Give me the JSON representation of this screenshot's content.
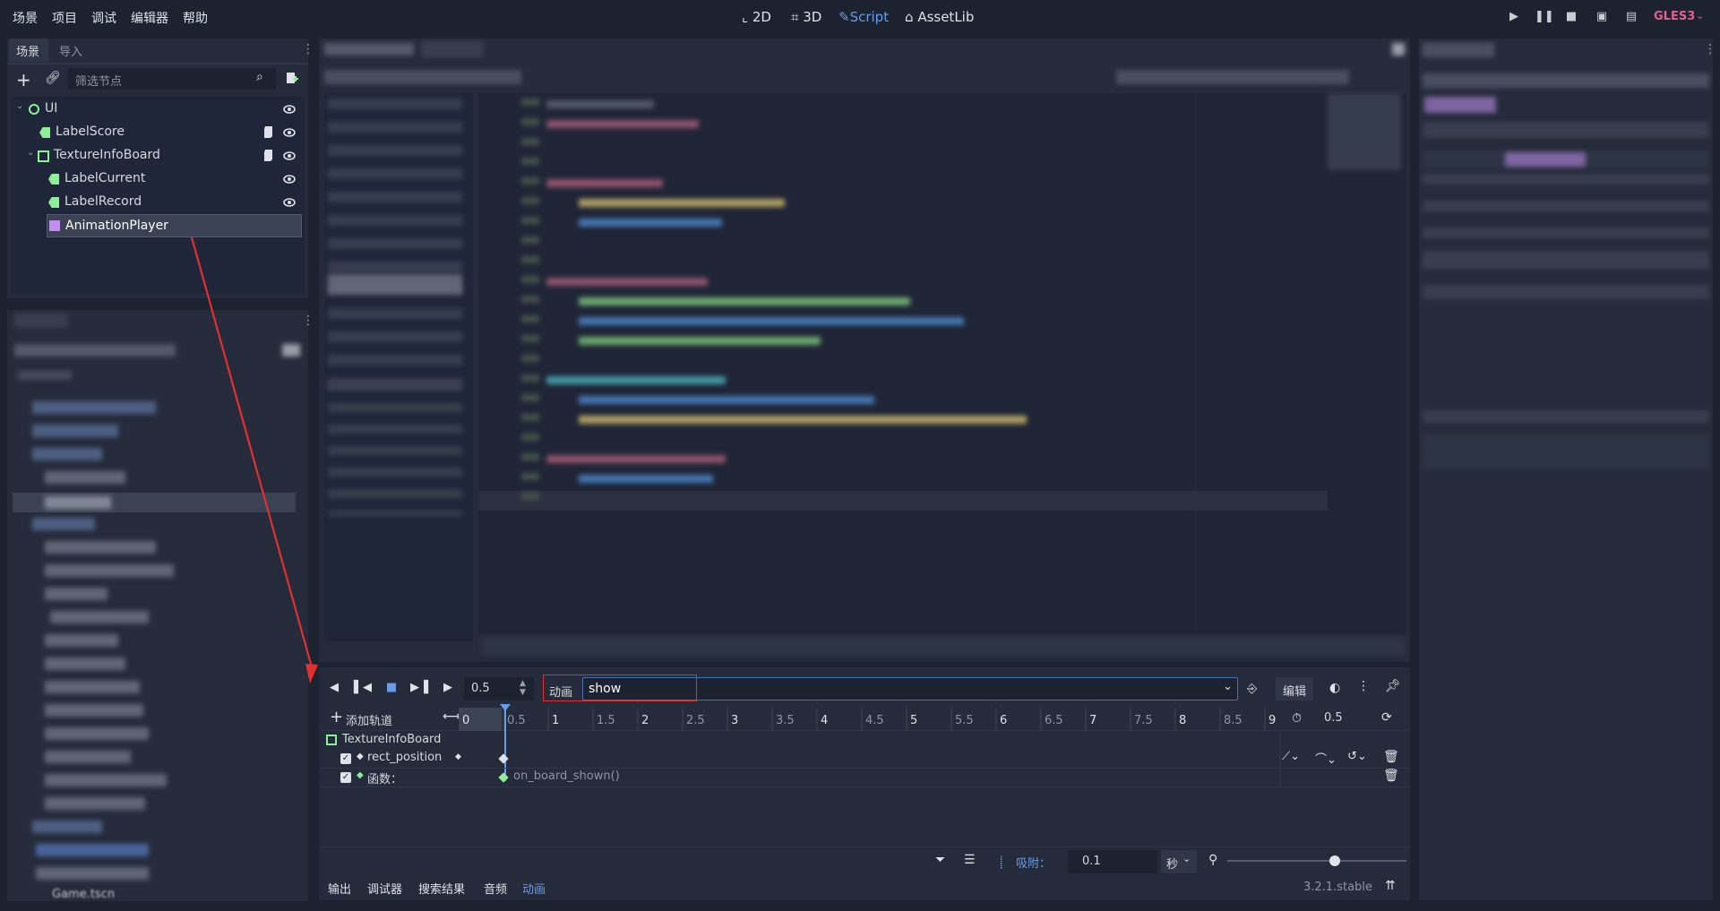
{
  "menu": [
    "场景",
    "项目",
    "调试",
    "编辑器",
    "帮助"
  ],
  "workspace": {
    "btn_2d": "2D",
    "btn_3d": "3D",
    "btn_script": "Script",
    "btn_assetlib": "AssetLib"
  },
  "renderer": "GLES3",
  "scene_dock": {
    "tabs": [
      "场景",
      "导入"
    ],
    "filter_placeholder": "筛选节点",
    "nodes": [
      {
        "label": "UI",
        "icon": "control-icon"
      },
      {
        "label": "LabelScore",
        "icon": "label-icon"
      },
      {
        "label": "TextureInfoBoard",
        "icon": "texture-rect-icon"
      },
      {
        "label": "LabelCurrent",
        "icon": "label-icon"
      },
      {
        "label": "LabelRecord",
        "icon": "label-icon"
      },
      {
        "label": "AnimationPlayer",
        "icon": "animation-player-icon"
      }
    ]
  },
  "animation": {
    "time_value": "0.5",
    "anim_label": "动画",
    "anim_name": "show",
    "edit_label": "编辑",
    "add_track": "添加轨道",
    "ruler": [
      "0",
      "0.5",
      "1",
      "1.5",
      "2",
      "2.5",
      "3",
      "3.5",
      "4",
      "4.5",
      "5",
      "5.5",
      "6",
      "6.5",
      "7",
      "7.5",
      "8",
      "8.5",
      "9"
    ],
    "length": "0.5",
    "track_group": "TextureInfoBoard",
    "tracks": [
      {
        "name": "rect_position"
      },
      {
        "name": "函数："
      }
    ],
    "function_key": "on_board_shown()",
    "snap_label": "吸附：",
    "snap_value": "0.1",
    "snap_unit": "秒",
    "zoom_level": 0.6
  },
  "bottom_tabs": [
    "输出",
    "调试器",
    "搜索结果",
    "音频",
    "动画"
  ],
  "version": "3.2.1.stable",
  "filesystem_partial": "Game.tscn",
  "colors": {
    "accent": "#699ce8",
    "red_annotation": "#e03030",
    "renderer": "#e0608e",
    "label_icon": "#8eef97"
  }
}
